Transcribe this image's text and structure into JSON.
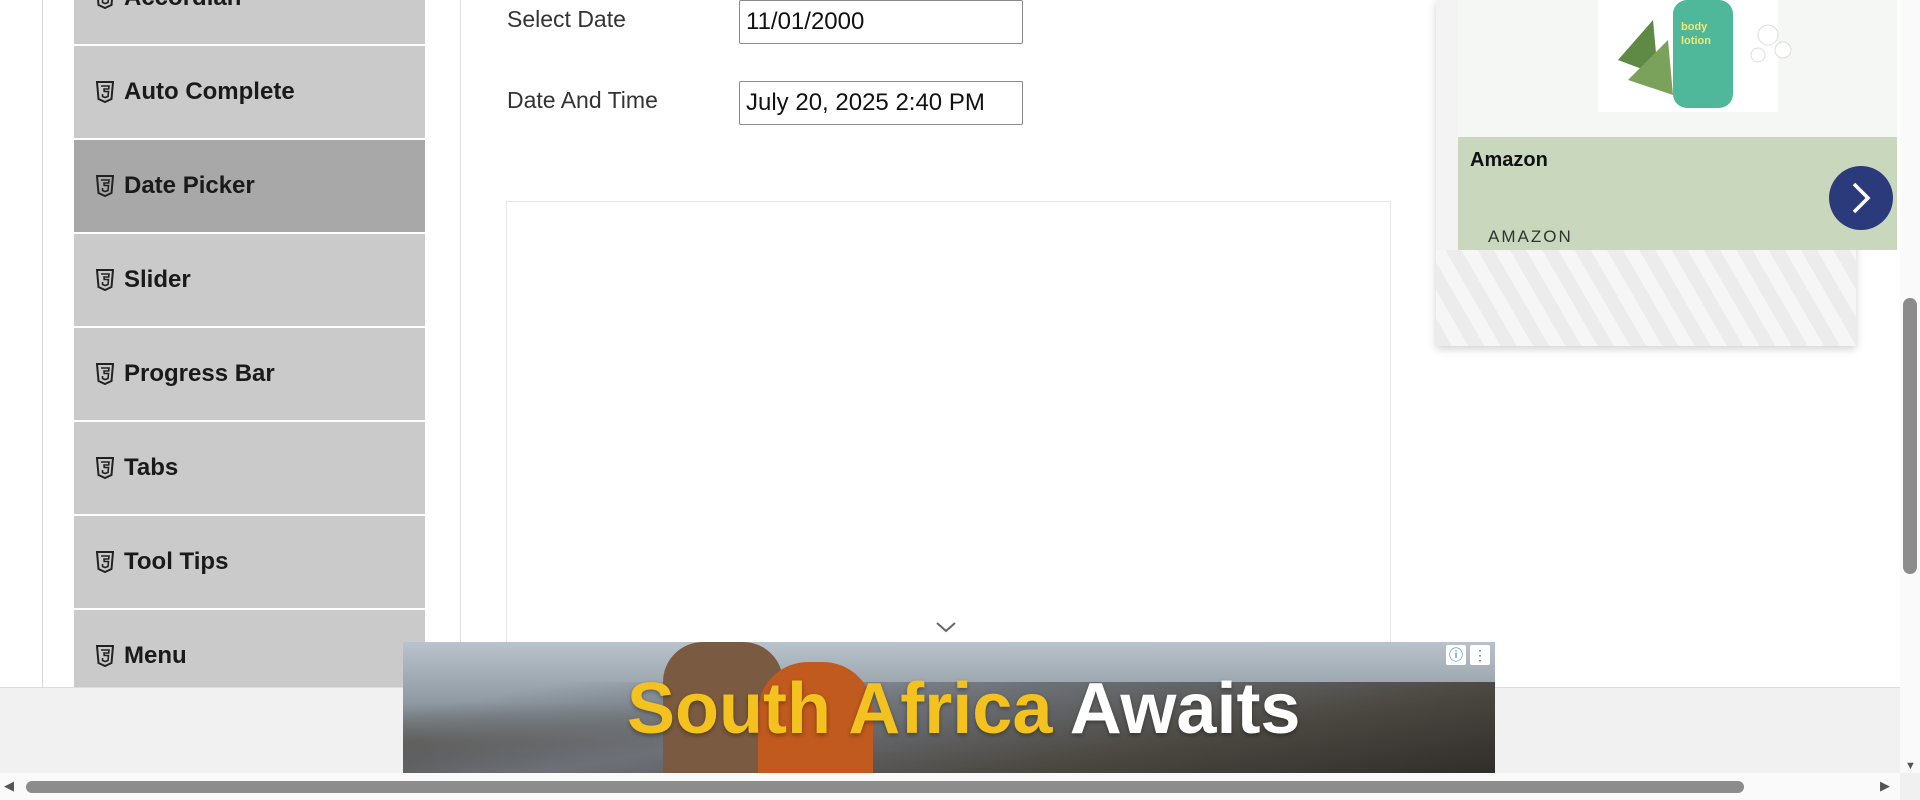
{
  "sidebar": {
    "items": [
      {
        "label": "Accordian",
        "active": false
      },
      {
        "label": "Auto Complete",
        "active": false
      },
      {
        "label": "Date Picker",
        "active": true
      },
      {
        "label": "Slider",
        "active": false
      },
      {
        "label": "Progress Bar",
        "active": false
      },
      {
        "label": "Tabs",
        "active": false
      },
      {
        "label": "Tool Tips",
        "active": false
      },
      {
        "label": "Menu",
        "active": false
      }
    ],
    "item_icon": "html5-icon"
  },
  "form": {
    "select_date_label": "Select Date",
    "select_date_value": "11/01/2000",
    "date_time_label": "Date And Time",
    "date_time_value": "July 20, 2025 2:40 PM"
  },
  "right_ad": {
    "brand": "Amazon",
    "sub_brand": "AMAZON",
    "band_color": "#c9d8bd",
    "button_color": "#2b3a7a"
  },
  "banner_ad": {
    "headline_highlight": "South Africa",
    "headline_rest": "Awaits",
    "highlight_color": "#f4c21e"
  },
  "colors": {
    "sidebar_bg": "#cacaca",
    "sidebar_active_bg": "#a8a8a8"
  }
}
